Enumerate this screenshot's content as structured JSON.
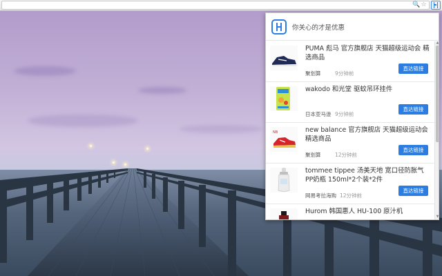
{
  "popup": {
    "title": "你关心的才是优惠",
    "items": [
      {
        "title": "PUMA 彪马 官方旗舰店 天猫超级运动会 精选商品",
        "source": "聚划算",
        "time": "9分钟前",
        "button": "直达链接",
        "thumb": "sneaker-icon"
      },
      {
        "title": "wakodo 和光堂 驱蚊吊环挂件",
        "source": "日本亚马逊",
        "time": "9分钟前",
        "button": "直达链接",
        "thumb": "repellent-pack-icon"
      },
      {
        "title": "new balance 官方旗舰店 天猫超级运动会 精选商品",
        "source": "聚划算",
        "time": "12分钟前",
        "button": "直达链接",
        "thumb": "red-sneaker-icon"
      },
      {
        "title": "tommee tippee 汤美天地 宽口径防胀气PP奶瓶 150ml*2个装*2件",
        "source": "网易考拉海购",
        "time": "12分钟前",
        "button": "直达链接",
        "thumb": "baby-bottle-icon"
      },
      {
        "title": "Hurom 韩国惠人 HU-100 原汁机",
        "source": "",
        "time": "",
        "button": "",
        "thumb": "juicer-icon"
      }
    ]
  }
}
